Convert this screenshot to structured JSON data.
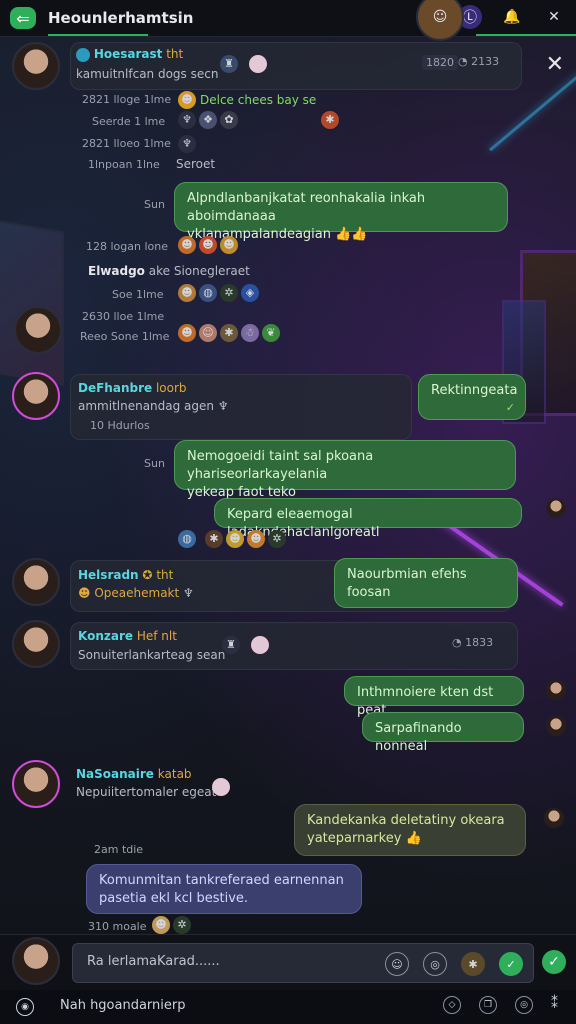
{
  "header": {
    "title": "Heounlerhamtsin"
  },
  "messages": {
    "m1": {
      "name": "Hoesarast",
      "tag": "tht",
      "sub": "kamuitnlfcan dogs secn",
      "badge": "1820",
      "time": "2133"
    },
    "r1": {
      "time": "2821 lloge 1lme",
      "text": "Delce chees bay se"
    },
    "r2": {
      "time": "Seerde 1 lme"
    },
    "r3": {
      "time": "2821 lloeo 1lme"
    },
    "r4": {
      "time": "1lnpoan 1lne",
      "text": "Seroet"
    },
    "b1": {
      "time": "Sun",
      "text": "Alpndlanbanjkatat reonhakalia inkah aboimdanaaa",
      "text2": "yklanampalandeagian 👍👍"
    },
    "r5": {
      "time": "128 logan lone"
    },
    "r6": {
      "name": "Elwadgo",
      "text": "ake Sionegleraet"
    },
    "r7": {
      "time": "Soe 1lme"
    },
    "r8": {
      "time": "2630 lloe 1lme"
    },
    "r9": {
      "time": "Reeo Sone 1lme"
    },
    "m2": {
      "name": "DeFhanbre",
      "tag": "loorb",
      "sub": "ammitlnenandag agen",
      "time": "10 Hdurlos",
      "reply": "Rektinngeata"
    },
    "b2": {
      "time": "Sun",
      "text": "Nemogoeidi taint sal pkoana yhariseorlarkayelania",
      "text2": "yekeap faot teko"
    },
    "b3": {
      "text": "Kepard eleaemogal ladakndehaclanlgoreatl"
    },
    "m3": {
      "name": "Helsradn",
      "tag": "tht",
      "sub": "Opeaehemakt",
      "reply": "Naourbmian efehs foosan"
    },
    "m4": {
      "name": "Konzare",
      "tag": "Hef nlt",
      "sub": "Sonuiterlankarteag sean",
      "time": "1833"
    },
    "b4": {
      "text": "Inthmnoiere kten dst peat"
    },
    "b5": {
      "text": "Sarpafinando nonneal"
    },
    "m5": {
      "name": "NaSoanaire",
      "tag": "katab",
      "sub": "Nepuiitertomaler egeat"
    },
    "b6": {
      "text": "Kandekanka deletatiny okeara",
      "text2": "yateparnarkey 👍"
    },
    "r10": {
      "time": "2am tdie"
    },
    "b7": {
      "text": "Komunmitan tankreferaed earnennan",
      "text2": "pasetia ekl kcl bestive."
    },
    "r11": {
      "time": "310 moale"
    }
  },
  "composer": {
    "placeholder": "Ra lerlamaKarad......"
  },
  "bottom": {
    "label": "Nah hgoandarnierp"
  },
  "colors": {
    "accent": "#2fae5b",
    "bubble_green": "#2f6b3a",
    "bubble_blue": "#3b3f6e",
    "name_cyan": "#5ad6e0",
    "avatar_ring": "#d24bd8"
  }
}
